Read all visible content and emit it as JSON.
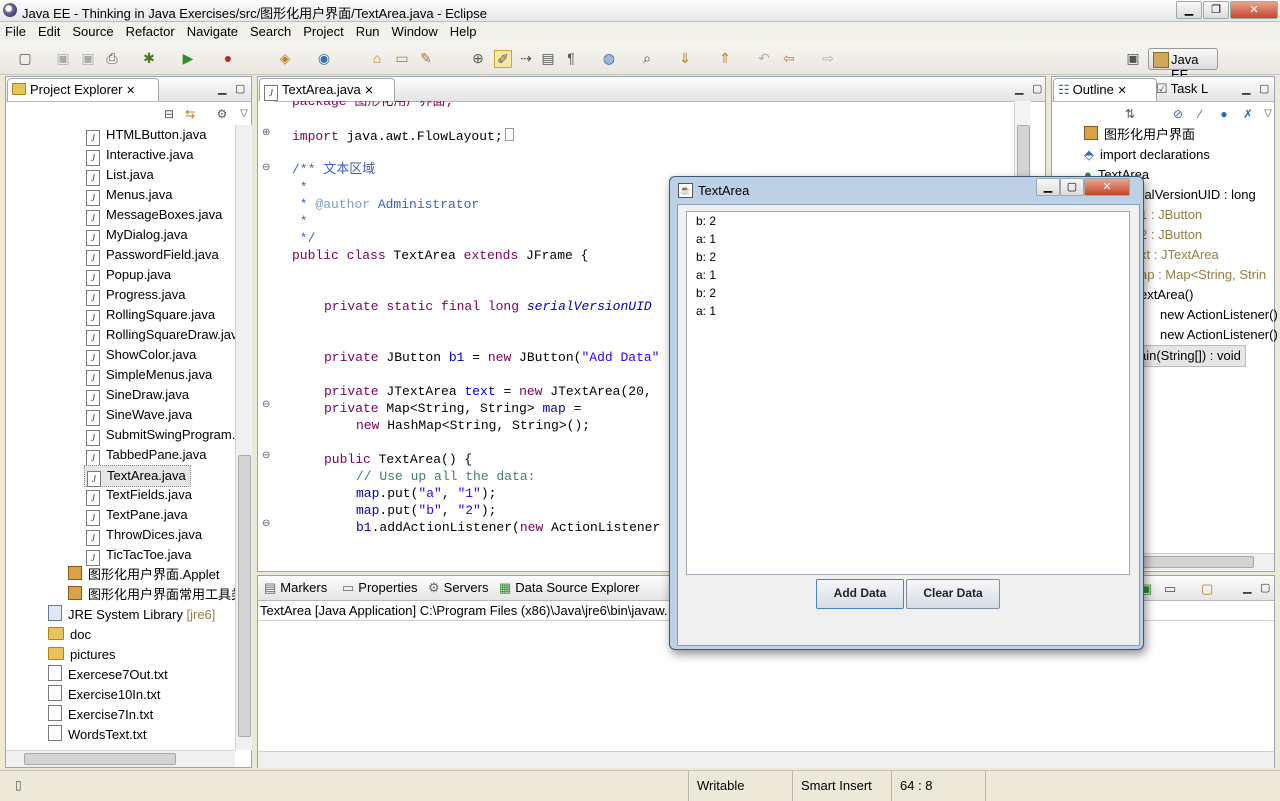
{
  "window": {
    "title": "Java EE - Thinking in Java Exercises/src/图形化用户界面/TextArea.java - Eclipse"
  },
  "menu": [
    "File",
    "Edit",
    "Source",
    "Refactor",
    "Navigate",
    "Search",
    "Project",
    "Run",
    "Window",
    "Help"
  ],
  "perspective": {
    "label": "Java EE"
  },
  "project_explorer": {
    "title": "Project Explorer",
    "files": [
      "HTMLButton.java",
      "Interactive.java",
      "List.java",
      "Menus.java",
      "MessageBoxes.java",
      "MyDialog.java",
      "PasswordField.java",
      "Popup.java",
      "Progress.java",
      "RollingSquare.java",
      "RollingSquareDraw.java",
      "ShowColor.java",
      "SimpleMenus.java",
      "SineDraw.java",
      "SineWave.java",
      "SubmitSwingProgram.java",
      "TabbedPane.java",
      "TextArea.java",
      "TextFields.java",
      "TextPane.java",
      "ThrowDices.java",
      "TicTacToe.java"
    ],
    "packages": [
      "图形化用户界面.Applet",
      "图形化用户界面常用工具类"
    ],
    "jre": {
      "label": "JRE System Library",
      "version": "[jre6]"
    },
    "folders": [
      "doc",
      "pictures"
    ],
    "other_files": [
      "Exercese7Out.txt",
      "Exercise10In.txt",
      "Exercise7In.txt",
      "WordsText.txt"
    ]
  },
  "editor": {
    "tab": "TextArea.java",
    "lines": {
      "l0": "package 图形化用户界面;",
      "l1_kw": "import",
      "l1_rest": " java.awt.FlowLayout;",
      "l2_open": "/** ",
      "l2_text": "文本区域",
      "l3": " *",
      "l4_pre": " * ",
      "l4_tag": "@author",
      "l4_rest": " Administrator",
      "l5": " *",
      "l6": " */",
      "l7_kw": "public class",
      "l7_name": " TextArea ",
      "l7_kw2": "extends",
      "l7_rest": " JFrame {",
      "l8_kw": "private static final long",
      "l8_fld": "serialVersionUID",
      "l9_kw": "private",
      "l9_type": " JButton ",
      "l9_fld": "b1",
      "l9_mid": " = ",
      "l9_kw2": "new",
      "l9_call": " JButton(",
      "l9_str": "\"Add Data\"",
      "l10_kw": "private",
      "l10_type": " JTextArea ",
      "l10_fld": "text",
      "l10_mid": " = ",
      "l10_kw2": "new",
      "l10_call": " JTextArea(20,",
      "l11_kw": "private",
      "l11_type": " Map<String, String> ",
      "l11_fld": "map",
      "l11_eq": " =",
      "l12_kw": "new",
      "l12_rest": " HashMap<String, String>();",
      "l13_kw": "public",
      "l13_rest": " TextArea() {",
      "l14": "// Use up all the data:",
      "l15_fld": "map",
      "l15_call": ".put(",
      "l15_s1": "\"a\"",
      "l15_sep": ", ",
      "l15_s2": "\"1\"",
      "l15_end": ");",
      "l16_fld": "map",
      "l16_call": ".put(",
      "l16_s1": "\"b\"",
      "l16_sep": ", ",
      "l16_s2": "\"2\"",
      "l16_end": ");",
      "l17_fld": "b1",
      "l17_call": ".addActionListener(",
      "l17_kw": "new",
      "l17_rest": " ActionListener"
    }
  },
  "outline": {
    "tabs": [
      "Outline",
      "Task L"
    ],
    "items": [
      "图形化用户界面",
      "import declarations",
      "TextArea",
      "erialVersionUID : long",
      "1 : JButton",
      "2 : JButton",
      "xt : JTextArea",
      "ap : Map<String, Strin",
      "extArea()",
      "new ActionListener()",
      "new ActionListener()",
      "ain(String[]) : void"
    ]
  },
  "bottom_panel": {
    "tabs": [
      "Markers",
      "Properties",
      "Servers",
      "Data Source Explorer"
    ],
    "console_label": "TextArea [Java Application] C:\\Program Files (x86)\\Java\\jre6\\bin\\javaw."
  },
  "dialog": {
    "title": "TextArea",
    "lines": [
      "b: 2",
      "a: 1",
      "b: 2",
      "a: 1",
      "b: 2",
      "a: 1"
    ],
    "add_button": "Add Data",
    "clear_button": "Clear Data"
  },
  "statusbar": {
    "writable": "Writable",
    "insert_mode": "Smart Insert",
    "position": "64 : 8"
  }
}
